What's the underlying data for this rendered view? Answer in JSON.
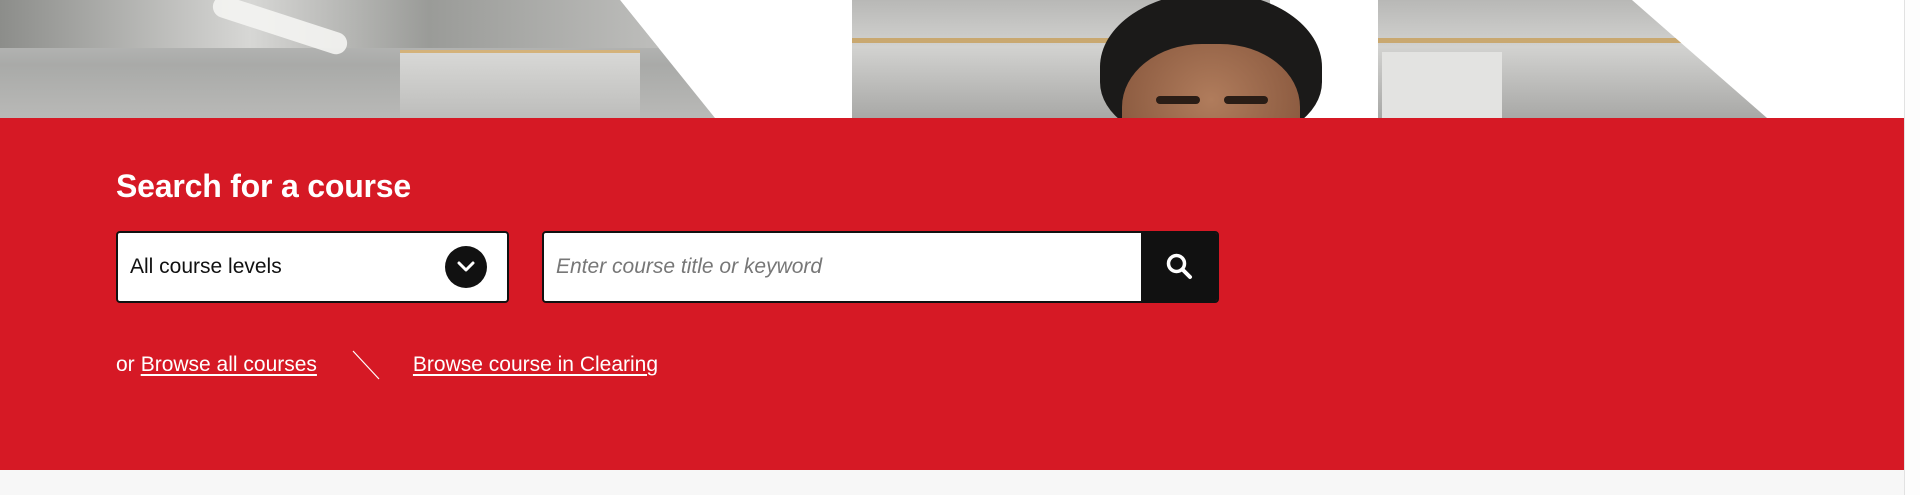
{
  "colors": {
    "panel_red": "#d61925",
    "black": "#111111",
    "white": "#ffffff"
  },
  "search": {
    "title": "Search for a course",
    "level_select": {
      "selected": "All course levels",
      "icon": "chevron-down-icon"
    },
    "input": {
      "value": "",
      "placeholder": "Enter course title or keyword"
    },
    "submit_icon": "search-icon"
  },
  "browse": {
    "prefix": "or",
    "all_courses_label": "Browse all courses",
    "clearing_label": "Browse course in Clearing",
    "divider_icon": "slash-divider"
  }
}
